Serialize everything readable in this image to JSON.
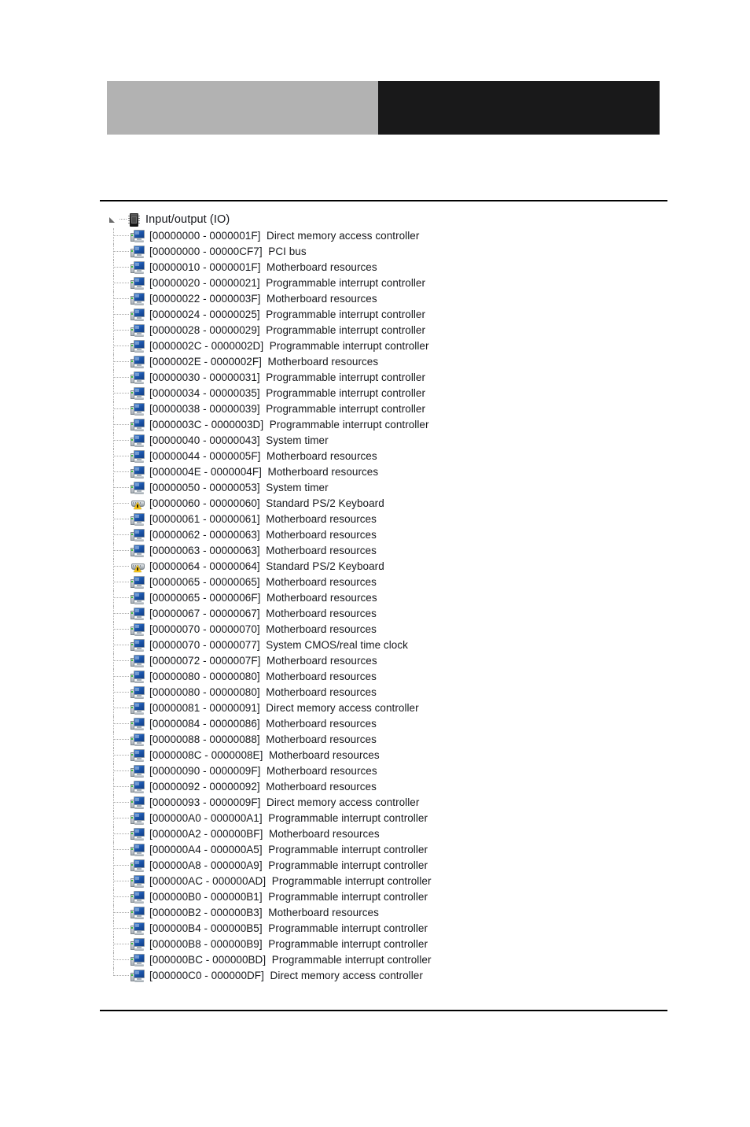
{
  "header": {
    "left_block_color": "#b2b2b2",
    "right_block_color": "#19191a"
  },
  "tree": {
    "root": {
      "label": "Input/output (IO)",
      "icon": "memory-chip-icon",
      "expander": "triangle-expanded-icon",
      "expanded": true
    },
    "rows": [
      {
        "address": "[00000000 - 0000001F]",
        "description": "Direct memory access controller",
        "icon": "computer-monitor-icon"
      },
      {
        "address": "[00000000 - 00000CF7]",
        "description": "PCI bus",
        "icon": "computer-monitor-icon"
      },
      {
        "address": "[00000010 - 0000001F]",
        "description": "Motherboard resources",
        "icon": "computer-monitor-icon"
      },
      {
        "address": "[00000020 - 00000021]",
        "description": "Programmable interrupt controller",
        "icon": "computer-monitor-icon"
      },
      {
        "address": "[00000022 - 0000003F]",
        "description": "Motherboard resources",
        "icon": "computer-monitor-icon"
      },
      {
        "address": "[00000024 - 00000025]",
        "description": "Programmable interrupt controller",
        "icon": "computer-monitor-icon"
      },
      {
        "address": "[00000028 - 00000029]",
        "description": "Programmable interrupt controller",
        "icon": "computer-monitor-icon"
      },
      {
        "address": "[0000002C - 0000002D]",
        "description": "Programmable interrupt controller",
        "icon": "computer-monitor-icon"
      },
      {
        "address": "[0000002E - 0000002F]",
        "description": "Motherboard resources",
        "icon": "computer-monitor-icon"
      },
      {
        "address": "[00000030 - 00000031]",
        "description": "Programmable interrupt controller",
        "icon": "computer-monitor-icon"
      },
      {
        "address": "[00000034 - 00000035]",
        "description": "Programmable interrupt controller",
        "icon": "computer-monitor-icon"
      },
      {
        "address": "[00000038 - 00000039]",
        "description": "Programmable interrupt controller",
        "icon": "computer-monitor-icon"
      },
      {
        "address": "[0000003C - 0000003D]",
        "description": "Programmable interrupt controller",
        "icon": "computer-monitor-icon"
      },
      {
        "address": "[00000040 - 00000043]",
        "description": "System timer",
        "icon": "computer-monitor-icon"
      },
      {
        "address": "[00000044 - 0000005F]",
        "description": "Motherboard resources",
        "icon": "computer-monitor-icon"
      },
      {
        "address": "[0000004E - 0000004F]",
        "description": "Motherboard resources",
        "icon": "computer-monitor-icon"
      },
      {
        "address": "[00000050 - 00000053]",
        "description": "System timer",
        "icon": "computer-monitor-icon"
      },
      {
        "address": "[00000060 - 00000060]",
        "description": "Standard PS/2 Keyboard",
        "icon": "keyboard-warning-icon"
      },
      {
        "address": "[00000061 - 00000061]",
        "description": "Motherboard resources",
        "icon": "computer-monitor-icon"
      },
      {
        "address": "[00000062 - 00000063]",
        "description": "Motherboard resources",
        "icon": "computer-monitor-icon"
      },
      {
        "address": "[00000063 - 00000063]",
        "description": "Motherboard resources",
        "icon": "computer-monitor-icon"
      },
      {
        "address": "[00000064 - 00000064]",
        "description": "Standard PS/2 Keyboard",
        "icon": "keyboard-warning-icon"
      },
      {
        "address": "[00000065 - 00000065]",
        "description": "Motherboard resources",
        "icon": "computer-monitor-icon"
      },
      {
        "address": "[00000065 - 0000006F]",
        "description": "Motherboard resources",
        "icon": "computer-monitor-icon"
      },
      {
        "address": "[00000067 - 00000067]",
        "description": "Motherboard resources",
        "icon": "computer-monitor-icon"
      },
      {
        "address": "[00000070 - 00000070]",
        "description": "Motherboard resources",
        "icon": "computer-monitor-icon"
      },
      {
        "address": "[00000070 - 00000077]",
        "description": "System CMOS/real time clock",
        "icon": "computer-monitor-icon"
      },
      {
        "address": "[00000072 - 0000007F]",
        "description": "Motherboard resources",
        "icon": "computer-monitor-icon"
      },
      {
        "address": "[00000080 - 00000080]",
        "description": "Motherboard resources",
        "icon": "computer-monitor-icon"
      },
      {
        "address": "[00000080 - 00000080]",
        "description": "Motherboard resources",
        "icon": "computer-monitor-icon"
      },
      {
        "address": "[00000081 - 00000091]",
        "description": "Direct memory access controller",
        "icon": "computer-monitor-icon"
      },
      {
        "address": "[00000084 - 00000086]",
        "description": "Motherboard resources",
        "icon": "computer-monitor-icon"
      },
      {
        "address": "[00000088 - 00000088]",
        "description": "Motherboard resources",
        "icon": "computer-monitor-icon"
      },
      {
        "address": "[0000008C - 0000008E]",
        "description": "Motherboard resources",
        "icon": "computer-monitor-icon"
      },
      {
        "address": "[00000090 - 0000009F]",
        "description": "Motherboard resources",
        "icon": "computer-monitor-icon"
      },
      {
        "address": "[00000092 - 00000092]",
        "description": "Motherboard resources",
        "icon": "computer-monitor-icon"
      },
      {
        "address": "[00000093 - 0000009F]",
        "description": "Direct memory access controller",
        "icon": "computer-monitor-icon"
      },
      {
        "address": "[000000A0 - 000000A1]",
        "description": "Programmable interrupt controller",
        "icon": "computer-monitor-icon"
      },
      {
        "address": "[000000A2 - 000000BF]",
        "description": "Motherboard resources",
        "icon": "computer-monitor-icon"
      },
      {
        "address": "[000000A4 - 000000A5]",
        "description": "Programmable interrupt controller",
        "icon": "computer-monitor-icon"
      },
      {
        "address": "[000000A8 - 000000A9]",
        "description": "Programmable interrupt controller",
        "icon": "computer-monitor-icon"
      },
      {
        "address": "[000000AC - 000000AD]",
        "description": "Programmable interrupt controller",
        "icon": "computer-monitor-icon"
      },
      {
        "address": "[000000B0 - 000000B1]",
        "description": "Programmable interrupt controller",
        "icon": "computer-monitor-icon"
      },
      {
        "address": "[000000B2 - 000000B3]",
        "description": "Motherboard resources",
        "icon": "computer-monitor-icon"
      },
      {
        "address": "[000000B4 - 000000B5]",
        "description": "Programmable interrupt controller",
        "icon": "computer-monitor-icon"
      },
      {
        "address": "[000000B8 - 000000B9]",
        "description": "Programmable interrupt controller",
        "icon": "computer-monitor-icon"
      },
      {
        "address": "[000000BC - 000000BD]",
        "description": "Programmable interrupt controller",
        "icon": "computer-monitor-icon"
      },
      {
        "address": "[000000C0 - 000000DF]",
        "description": "Direct memory access controller",
        "icon": "computer-monitor-icon"
      }
    ]
  }
}
